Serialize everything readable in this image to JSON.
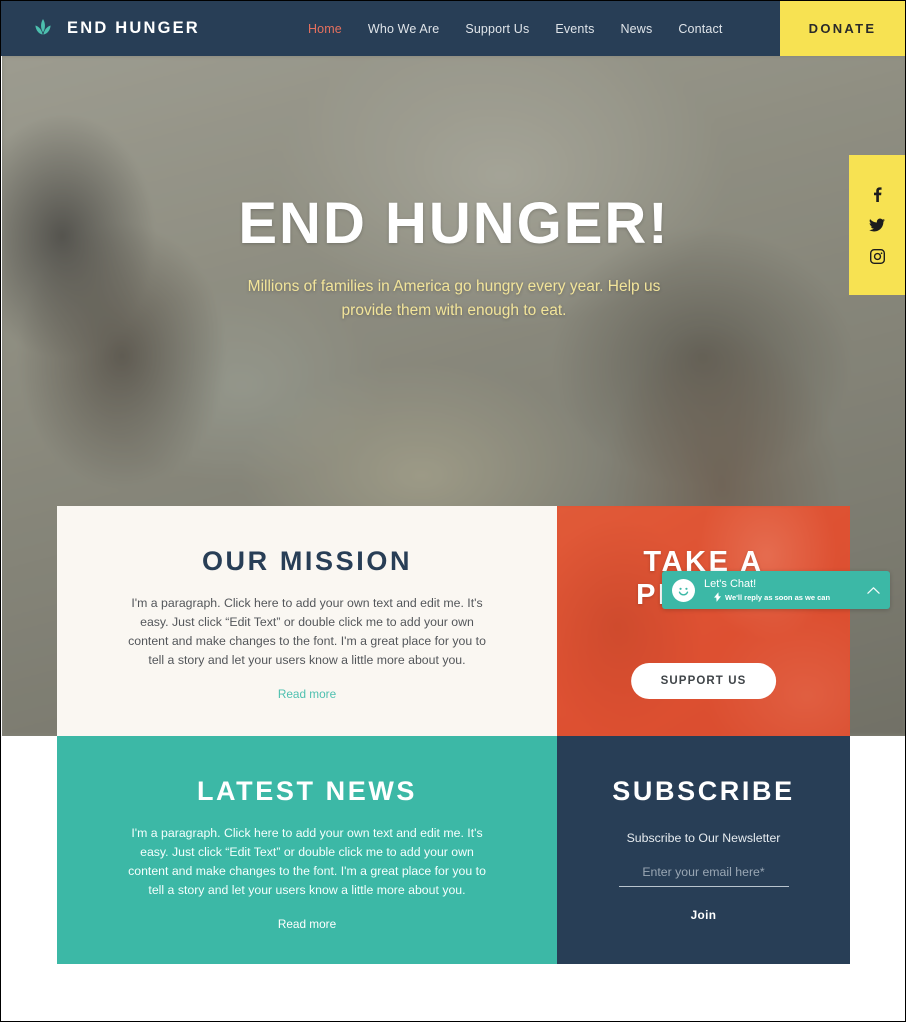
{
  "header": {
    "brand": {
      "name": "END HUNGER",
      "icon": "leaf-icon"
    },
    "nav": [
      {
        "label": "Home",
        "active": true
      },
      {
        "label": "Who We Are",
        "active": false
      },
      {
        "label": "Support Us",
        "active": false
      },
      {
        "label": "Events",
        "active": false
      },
      {
        "label": "News",
        "active": false
      },
      {
        "label": "Contact",
        "active": false
      }
    ],
    "donate_label": "DONATE",
    "colors": {
      "bar": "#283e56",
      "donate_bg": "#f7e252",
      "active_link": "#e4705e"
    }
  },
  "hero": {
    "title": "END HUNGER!",
    "subtitle": "Millions of families in America go hungry every year. Help us provide them with enough to eat.",
    "subtitle_color": "#f2e49a"
  },
  "social_rail": {
    "background": "#f7e252",
    "items": [
      {
        "icon": "facebook-icon",
        "label": "Facebook"
      },
      {
        "icon": "twitter-icon",
        "label": "Twitter"
      },
      {
        "icon": "instagram-icon",
        "label": "Instagram"
      }
    ]
  },
  "panels": {
    "mission": {
      "heading": "OUR MISSION",
      "body": "I'm a paragraph. Click here to add your own text and edit me. It's easy. Just click “Edit Text” or double click me to add your own content and make changes to the font. I'm a great place for you to tell a story and let your users know a little more about you.",
      "link": "Read more",
      "background": "#faf7f2",
      "link_color": "#4fc0b0"
    },
    "pledge": {
      "heading_line1": "TAKE A",
      "heading_line2": "PLEDGE",
      "button": "SUPPORT US",
      "background": "#de5132"
    },
    "news": {
      "heading": "LATEST NEWS",
      "body": "I'm a paragraph. Click here to add your own text and edit me. It's easy. Just click “Edit Text” or double click me to add your own content and make changes to the font. I'm a great place for you to tell a story and let your users know a little more about you.",
      "link": "Read more",
      "background": "#3cb8a6"
    },
    "subscribe": {
      "heading": "SUBSCRIBE",
      "note": "Subscribe to Our Newsletter",
      "email_placeholder": "Enter your email here*",
      "email_value": "",
      "join_label": "Join",
      "background": "#283e56"
    }
  },
  "chat_widget": {
    "title": "Let's Chat!",
    "subtitle": "We'll reply as soon as we can",
    "background": "#3cb8a6",
    "avatar_icon": "smiley-icon",
    "bolt_icon": "lightning-bolt-icon",
    "collapse_icon": "chevron-up-icon"
  }
}
